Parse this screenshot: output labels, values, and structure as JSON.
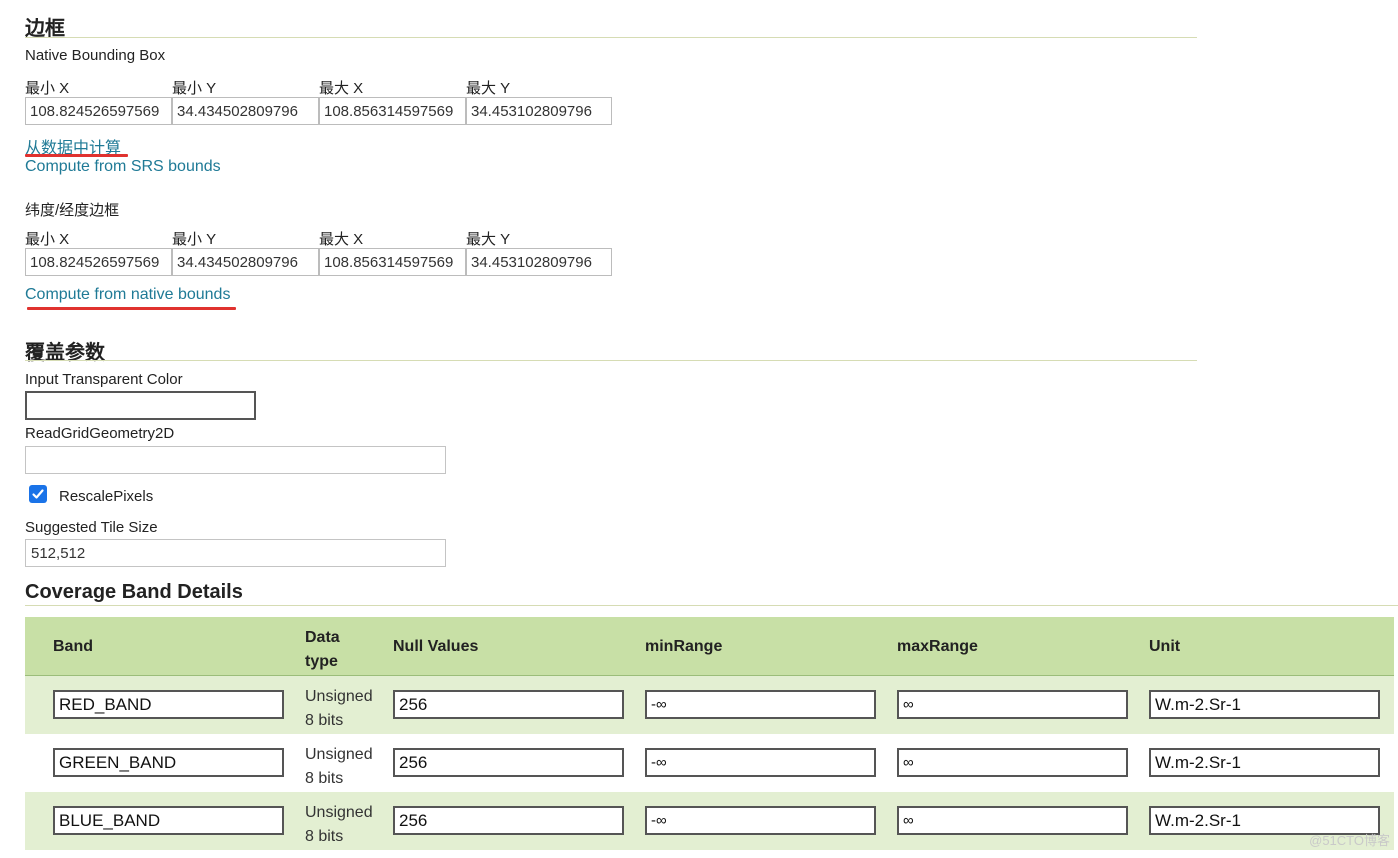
{
  "bbox_section": {
    "title": "边框",
    "native": {
      "label": "Native Bounding Box",
      "headers": [
        "最小 X",
        "最小 Y",
        "最大 X",
        "最大 Y"
      ],
      "values": [
        "108.824526597569",
        "34.434502809796",
        "108.856314597569",
        "34.453102809796"
      ]
    },
    "compute_from_data_link": "从数据中计算",
    "compute_from_srs_link": "Compute from SRS bounds",
    "latlon": {
      "label": "纬度/经度边框",
      "headers": [
        "最小 X",
        "最小 Y",
        "最大 X",
        "最大 Y"
      ],
      "values": [
        "108.824526597569",
        "34.434502809796",
        "108.856314597569",
        "34.453102809796"
      ]
    },
    "compute_from_native_link": "Compute from native bounds"
  },
  "coverage_params": {
    "title": "覆盖参数",
    "input_transparent_color": {
      "label": "Input Transparent Color",
      "value": ""
    },
    "read_grid_geometry": {
      "label": "ReadGridGeometry2D",
      "value": ""
    },
    "rescale_pixels": {
      "label": "RescalePixels",
      "checked": true
    },
    "suggested_tile_size": {
      "label": "Suggested Tile Size",
      "value": "512,512"
    }
  },
  "band_details": {
    "title": "Coverage Band Details",
    "columns": {
      "band": "Band",
      "data_type_line1": "Data",
      "data_type_line2": "type",
      "null_values": "Null Values",
      "min_range": "minRange",
      "max_range": "maxRange",
      "unit": "Unit"
    },
    "rows": [
      {
        "band": "RED_BAND",
        "type_line1": "Unsigned",
        "type_line2": "8 bits",
        "null_values": "256",
        "min_range": "-∞",
        "max_range": "∞",
        "unit": "W.m-2.Sr-1"
      },
      {
        "band": "GREEN_BAND",
        "type_line1": "Unsigned",
        "type_line2": "8 bits",
        "null_values": "256",
        "min_range": "-∞",
        "max_range": "∞",
        "unit": "W.m-2.Sr-1"
      },
      {
        "band": "BLUE_BAND",
        "type_line1": "Unsigned",
        "type_line2": "8 bits",
        "null_values": "256",
        "min_range": "-∞",
        "max_range": "∞",
        "unit": "W.m-2.Sr-1"
      }
    ]
  },
  "watermark": "@51CTO博客",
  "colors": {
    "link": "#1f7a96",
    "annotation_underline": "#e0322f",
    "table_header_bg": "#c8e0a6",
    "table_row_alt_bg": "#e3efd2",
    "checkbox": "#1a73e8"
  }
}
